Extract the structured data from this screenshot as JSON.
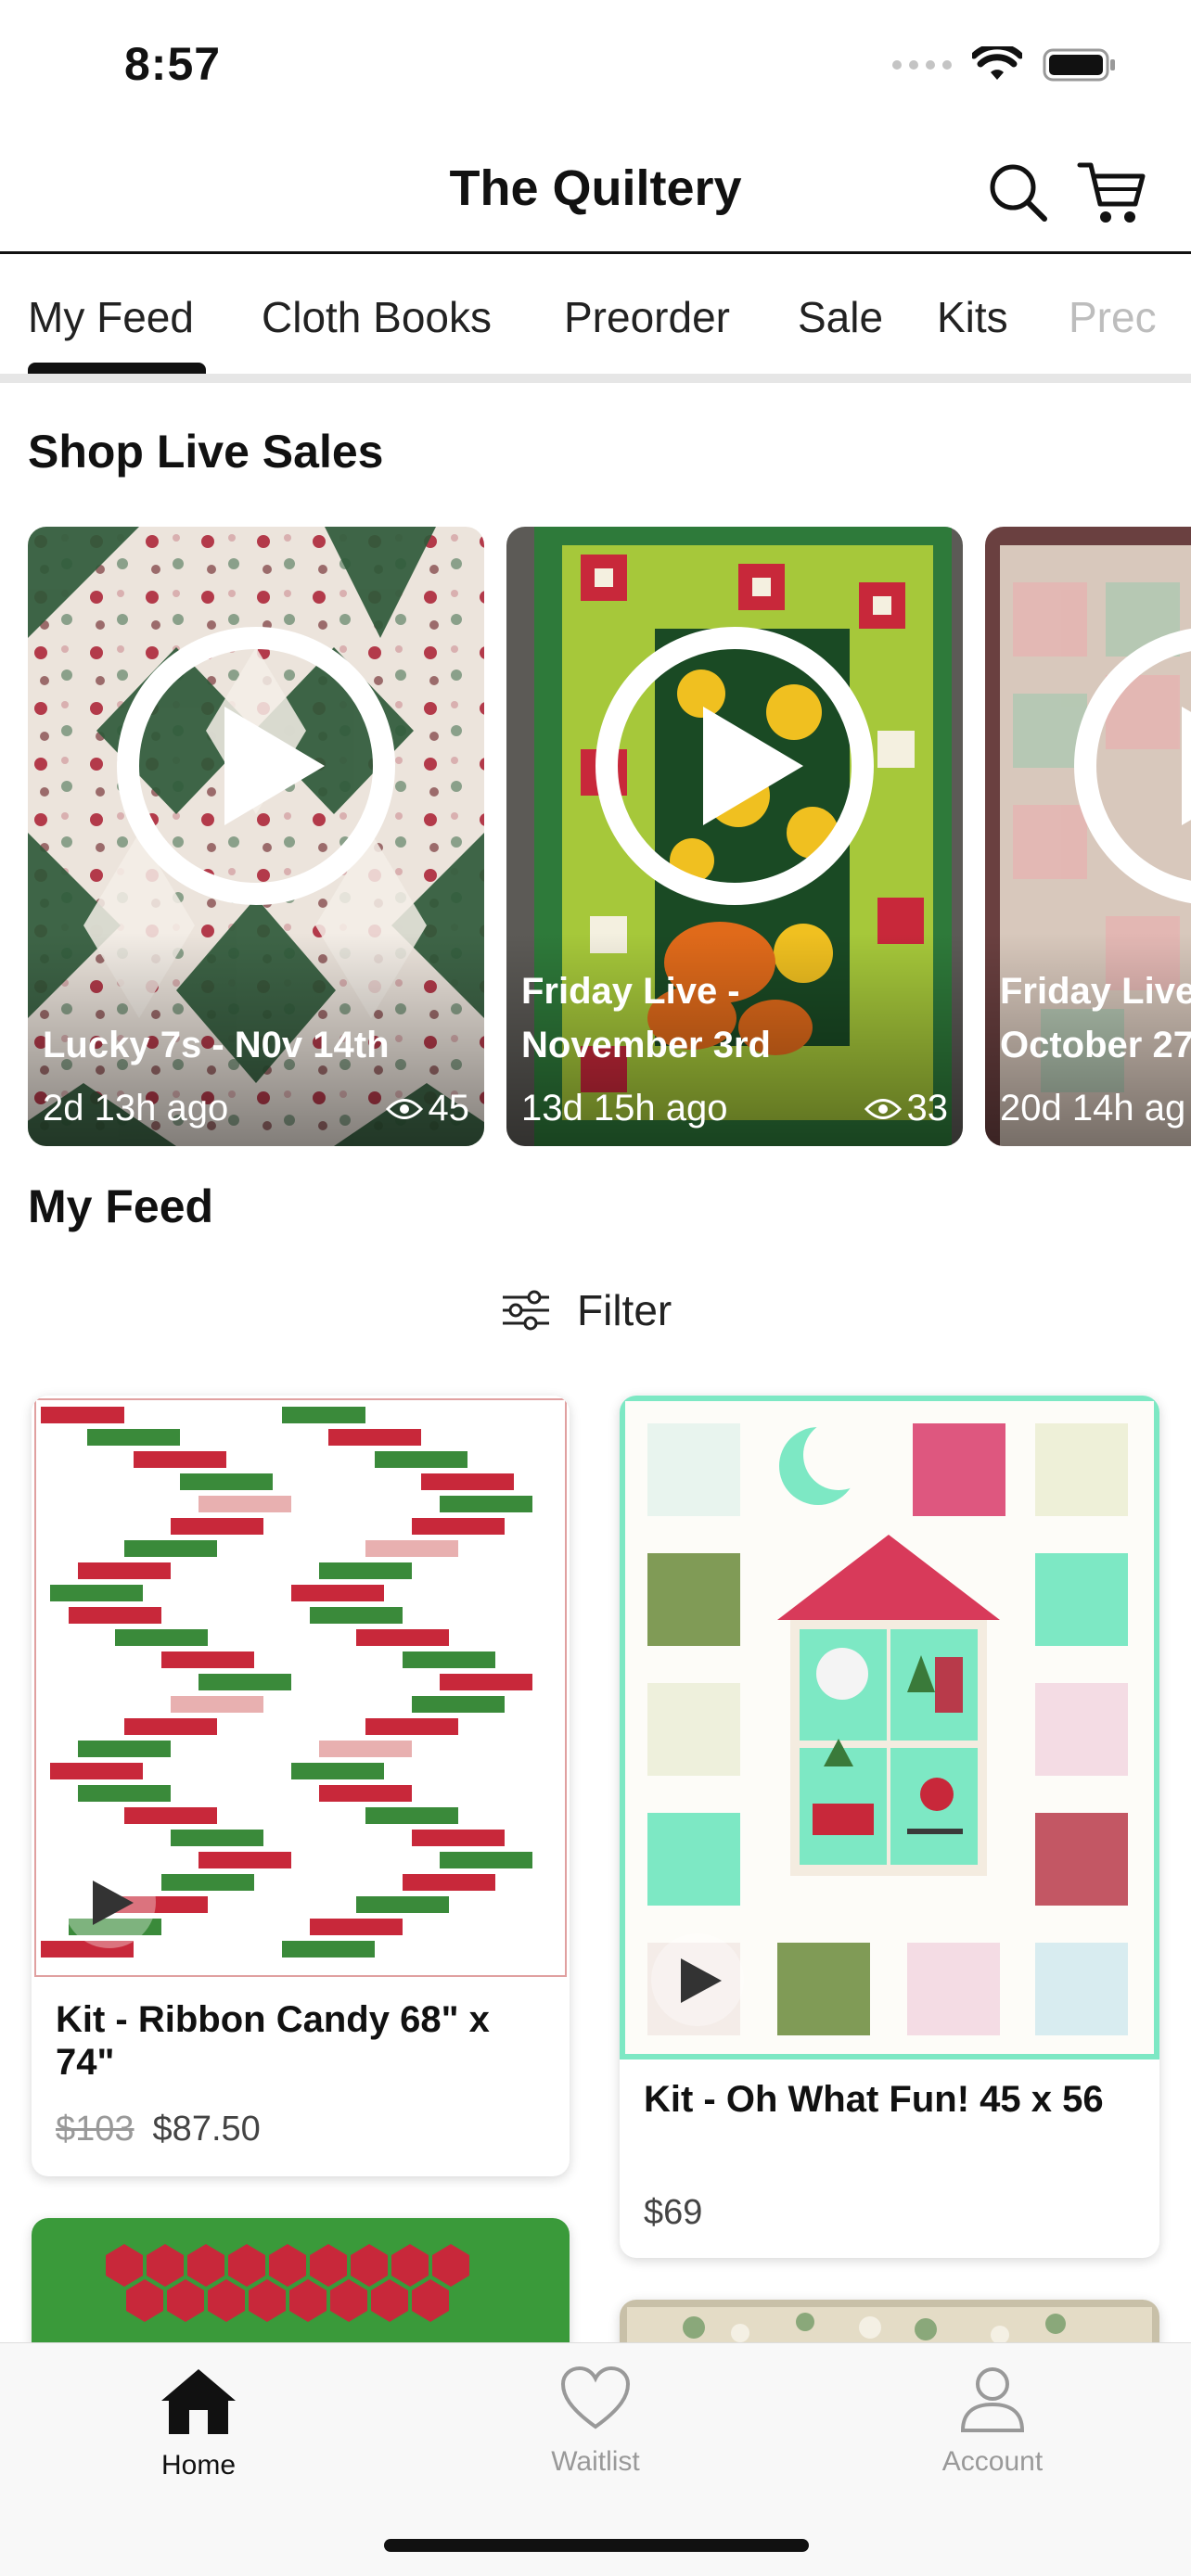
{
  "status": {
    "time": "8:57"
  },
  "header": {
    "title": "The Quiltery"
  },
  "tabs": [
    {
      "label": "My Feed"
    },
    {
      "label": "Cloth Books"
    },
    {
      "label": "Preorder"
    },
    {
      "label": "Sale"
    },
    {
      "label": "Kits"
    },
    {
      "label": "Prec"
    }
  ],
  "live_sales": {
    "title": "Shop Live Sales",
    "items": [
      {
        "title": "Lucky 7s - N0v 14th",
        "time": "2d 13h ago",
        "views": "45"
      },
      {
        "title": "Friday Live -\nNovember 3rd",
        "time": "13d 15h ago",
        "views": "33"
      },
      {
        "title": "Friday Live\nOctober 27",
        "time": "20d 14h ag",
        "views": ""
      }
    ]
  },
  "feed": {
    "title": "My Feed",
    "filter_label": "Filter",
    "products": [
      {
        "name": "Kit - Ribbon Candy 68\" x 74\"",
        "old_price": "$103",
        "price": "$87.50"
      },
      {
        "name": "Kit - Oh What Fun! 45 x 56",
        "old_price": "",
        "price": "$69"
      }
    ]
  },
  "bottom_nav": {
    "items": [
      {
        "label": "Home",
        "icon": "home-icon",
        "active": true
      },
      {
        "label": "Waitlist",
        "icon": "heart-icon",
        "active": false
      },
      {
        "label": "Account",
        "icon": "person-icon",
        "active": false
      }
    ]
  },
  "colors": {
    "active_tab": "#111111",
    "inactive_nav": "#999999",
    "quilt_green": "#2f6b3a",
    "quilt_red": "#c8283a",
    "mint": "#7de8c4"
  }
}
